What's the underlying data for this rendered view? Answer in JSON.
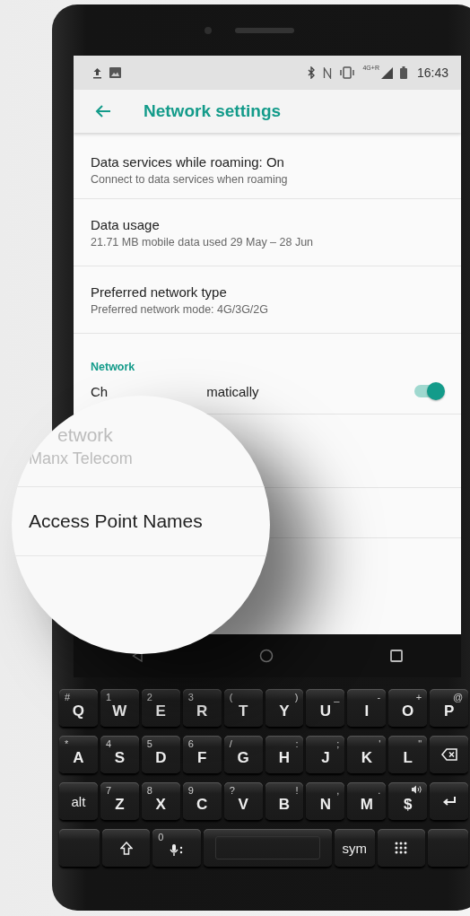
{
  "status_bar": {
    "network_type": "4G+R",
    "time": "16:43"
  },
  "toolbar": {
    "title": "Network settings"
  },
  "settings": [
    {
      "title": "Data services while roaming: On",
      "summary": "Connect to data services when roaming"
    },
    {
      "title": "Data usage",
      "summary": "21.71 MB mobile data used 29 May – 28 Jun"
    },
    {
      "title": "Preferred network type",
      "summary": "Preferred network mode: 4G/3G/2G"
    }
  ],
  "section": {
    "title": "Network"
  },
  "toggle_row": {
    "label_start": "Ch",
    "label_end": "matically",
    "on": true
  },
  "magnifier": {
    "rows": [
      {
        "title": "etwork",
        "summary": "Manx Telecom",
        "disabled": true
      },
      {
        "title": "Access Point Names",
        "disabled": false
      }
    ]
  },
  "keyboard": {
    "rows": [
      [
        {
          "kind": "leftalt",
          "label": "Q",
          "alt": "#"
        },
        {
          "kind": "leftalt",
          "label": "W",
          "alt": "1"
        },
        {
          "kind": "leftalt",
          "label": "E",
          "alt": "2"
        },
        {
          "kind": "leftalt",
          "label": "R",
          "alt": "3"
        },
        {
          "kind": "leftalt",
          "label": "T",
          "alt": "("
        },
        {
          "kind": "rightalt",
          "label": "Y",
          "alt": ")"
        },
        {
          "kind": "rightalt",
          "label": "U",
          "alt": "_"
        },
        {
          "kind": "rightalt",
          "label": "I",
          "alt": "-"
        },
        {
          "kind": "rightalt",
          "label": "O",
          "alt": "+"
        },
        {
          "kind": "rightalt",
          "label": "P",
          "alt": "@"
        }
      ],
      [
        {
          "kind": "leftalt",
          "label": "A",
          "alt": "*"
        },
        {
          "kind": "leftalt",
          "label": "S",
          "alt": "4"
        },
        {
          "kind": "leftalt",
          "label": "D",
          "alt": "5"
        },
        {
          "kind": "leftalt",
          "label": "F",
          "alt": "6"
        },
        {
          "kind": "leftalt",
          "label": "G",
          "alt": "/"
        },
        {
          "kind": "rightalt",
          "label": "H",
          "alt": ":"
        },
        {
          "kind": "rightalt",
          "label": "J",
          "alt": ";"
        },
        {
          "kind": "rightalt",
          "label": "K",
          "alt": "'"
        },
        {
          "kind": "rightalt",
          "label": "L",
          "alt": "\""
        },
        {
          "kind": "backspace"
        }
      ],
      [
        {
          "kind": "word",
          "label": "alt"
        },
        {
          "kind": "leftalt",
          "label": "Z",
          "alt": "7"
        },
        {
          "kind": "leftalt",
          "label": "X",
          "alt": "8"
        },
        {
          "kind": "leftalt",
          "label": "C",
          "alt": "9"
        },
        {
          "kind": "leftalt",
          "label": "V",
          "alt": "?"
        },
        {
          "kind": "rightalt",
          "label": "B",
          "alt": "!"
        },
        {
          "kind": "rightalt",
          "label": "N",
          "alt": ","
        },
        {
          "kind": "rightalt",
          "label": "M",
          "alt": "."
        },
        {
          "kind": "speaker",
          "label": "$"
        },
        {
          "kind": "enter"
        }
      ],
      [
        {
          "kind": "blank"
        },
        {
          "kind": "shift"
        },
        {
          "kind": "mic",
          "alt": "0"
        },
        {
          "kind": "space"
        },
        {
          "kind": "word",
          "label": "sym"
        },
        {
          "kind": "grid"
        },
        {
          "kind": "blank"
        }
      ]
    ]
  }
}
